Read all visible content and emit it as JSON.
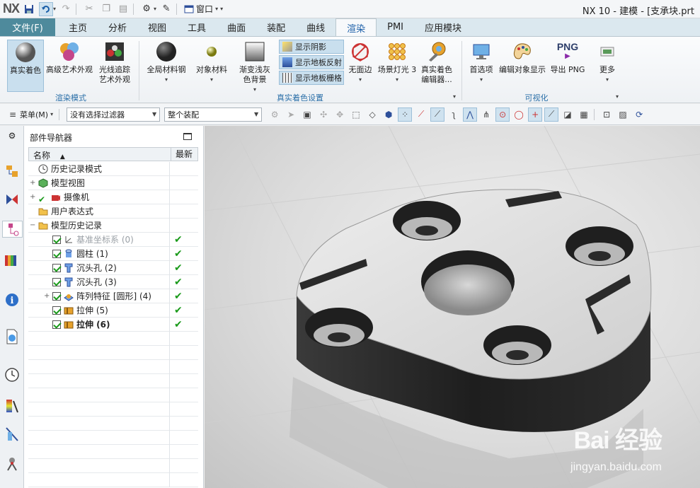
{
  "titlebar": {
    "logo": "NX",
    "window_menu": "窗口",
    "title": "NX 10 - 建模 - [支承块.prt"
  },
  "tabs": {
    "file": "文件(F)",
    "items": [
      "主页",
      "分析",
      "视图",
      "工具",
      "曲面",
      "装配",
      "曲线",
      "渲染",
      "PMI",
      "应用模块"
    ],
    "active": "渲染"
  },
  "ribbon": {
    "groups": {
      "render_mode": "渲染模式",
      "true_shading": "真实着色设置",
      "visualize": "可视化"
    },
    "buttons": {
      "true_shading": "真实着色",
      "advanced_studio": "高级艺术外观",
      "ray_trace_line1": "光线追踪",
      "ray_trace_line2": "艺术外观",
      "global_material": "全局材料钢",
      "object_material": "对象材料",
      "gradient_line1": "渐变浅灰",
      "gradient_line2": "色背景",
      "show_shadow": "显示阴影",
      "show_floor_reflect": "显示地板反射",
      "show_floor_grid": "显示地板栅格",
      "no_edges": "无面边",
      "scene_light": "场景灯光 3",
      "true_shading_editor_line1": "真实着色",
      "true_shading_editor_line2": "编辑器...",
      "preferences": "首选项",
      "edit_object_display": "编辑对象显示",
      "export_png": "导出 PNG",
      "more": "更多",
      "png_icon_text": "PNG"
    }
  },
  "selbar": {
    "menu": "菜单(M)",
    "filter": "没有选择过滤器",
    "scope": "整个装配"
  },
  "navigator": {
    "title": "部件导航器",
    "col_name": "名称",
    "col_latest": "最新",
    "rows": [
      {
        "label": "历史记录模式"
      },
      {
        "label": "模型视图"
      },
      {
        "label": "摄像机"
      },
      {
        "label": "用户表达式"
      },
      {
        "label": "模型历史记录"
      },
      {
        "label": "基准坐标系 (0)"
      },
      {
        "label": "圆柱 (1)"
      },
      {
        "label": "沉头孔 (2)"
      },
      {
        "label": "沉头孔 (3)"
      },
      {
        "label": "阵列特征 [圆形] (4)"
      },
      {
        "label": "拉伸 (5)"
      },
      {
        "label": "拉伸 (6)"
      }
    ]
  },
  "viewport": {
    "watermark": "Bai 经验",
    "watermark_url": "jingyan.baidu.com"
  },
  "colors": {
    "file_tab": "#4e8a9c",
    "accent": "#1a5ea8",
    "check": "#1a9a1a"
  }
}
